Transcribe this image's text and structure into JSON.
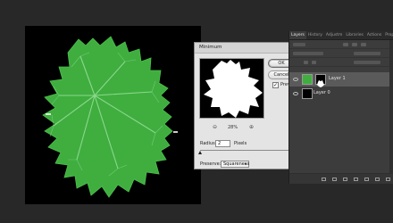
{
  "dialog": {
    "title": "Minimum",
    "ok_label": "OK",
    "cancel_label": "Cancel",
    "preview_checked": true,
    "preview_label": "Preview",
    "zoom_value": "28%",
    "radius_label": "Radius:",
    "radius_value": "2",
    "radius_unit": "Pixels",
    "preserve_label": "Preserve:",
    "preserve_value": "Squareness"
  },
  "panel": {
    "tabs": [
      {
        "label": "Layers",
        "active": true
      },
      {
        "label": "History",
        "active": false
      },
      {
        "label": "Adjustm",
        "active": false
      },
      {
        "label": "Libraries",
        "active": false
      },
      {
        "label": "Actions",
        "active": false
      },
      {
        "label": "Properti",
        "active": false
      }
    ],
    "layers": [
      {
        "name": "Layer 1",
        "selected": true,
        "visible": true
      },
      {
        "name": "Layer 0",
        "selected": false,
        "visible": true
      }
    ]
  },
  "colors": {
    "leaf": "#3fae3f",
    "leaf_vein": "#9fe29f",
    "app_bg": "#282828",
    "panel_bg": "#3c3c3c",
    "dialog_bg": "#e4e4e4"
  },
  "icons": {
    "zoom_out": "zoom-out-icon",
    "zoom_in": "zoom-in-icon",
    "visibility": "eye-icon"
  }
}
